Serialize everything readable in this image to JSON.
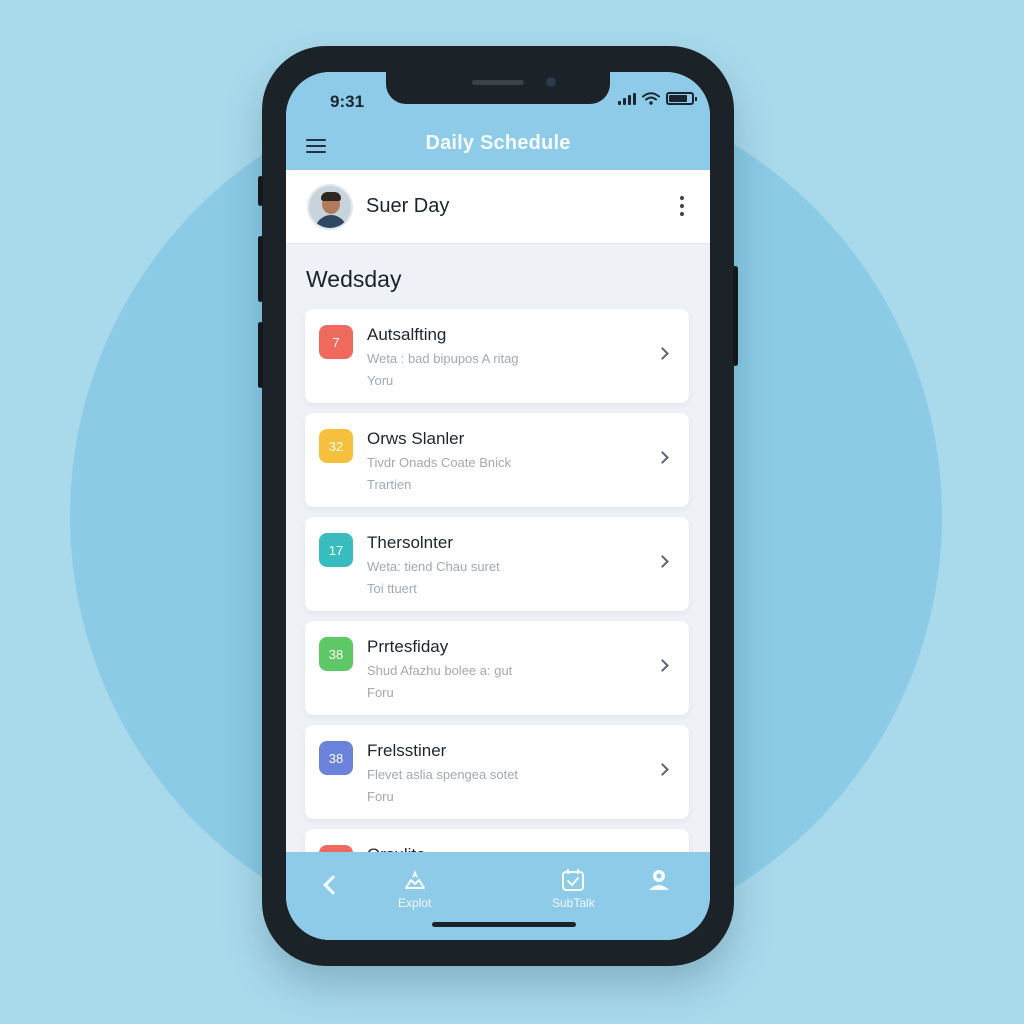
{
  "status_bar": {
    "time": "9:31"
  },
  "header": {
    "title": "Daily Schedule"
  },
  "user": {
    "name": "Suer Day"
  },
  "day_heading": "Wedsday",
  "schedule": [
    {
      "badge": "7",
      "badge_color": "#ef6a5c",
      "title": "Autsalfting",
      "subtitle": "Weta : bad bipupos A ritag",
      "meta": "Yoru"
    },
    {
      "badge": "32",
      "badge_color": "#f6bf3c",
      "title": "Orws Slanler",
      "subtitle": "Tivdr Onads Coate Bnick",
      "meta": "Trartien"
    },
    {
      "badge": "17",
      "badge_color": "#37bcc0",
      "title": "Thersolnter",
      "subtitle": "Weta: tiend Chau suret",
      "meta": "Toi ttuert"
    },
    {
      "badge": "38",
      "badge_color": "#5ec866",
      "title": "Prrtesfiday",
      "subtitle": "Shud Afazhu bolee a: gut",
      "meta": "Foru"
    },
    {
      "badge": "38",
      "badge_color": "#6b82dc",
      "title": "Frelsstiner",
      "subtitle": "Flevet aslia spengea sotet",
      "meta": "Foru"
    },
    {
      "badge": "",
      "badge_color": "#ef6a5c",
      "title": "Orsulite",
      "subtitle": "",
      "meta": ""
    }
  ],
  "bottom_nav": {
    "explore_label": "Explot",
    "subtask_label": "SubTalk"
  },
  "icons": {
    "menu": "menu-icon",
    "more": "more-vertical-icon",
    "back": "chevron-left-icon",
    "explore": "compass-icon",
    "subtask": "calendar-check-icon",
    "profile": "user-icon"
  },
  "colors": {
    "background": "#a9daec",
    "accent": "#8ecbe8"
  }
}
